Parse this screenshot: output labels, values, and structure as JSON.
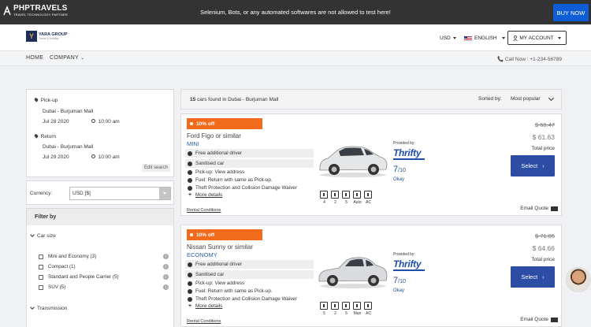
{
  "topbar": {
    "brand_name": "PHPTRAVELS",
    "brand_tagline": "TRAVEL TECHNOLOGY PARTNER",
    "notice": "Selenium, Bots, or any automated softwares are not allowed to test here!",
    "buy_now": "BUY NOW"
  },
  "header": {
    "logo_text": "YARA GROUP",
    "logo_sub": "Travel & Holiday",
    "currency": "USD",
    "language": "ENGLISH",
    "account": "MY ACCOUNT"
  },
  "nav": {
    "home": "HOME",
    "company": "COMPANY",
    "call": "Call Now : +1-234-56789"
  },
  "search": {
    "pickup_label": "Pick-up",
    "pickup_location": "Dubai - Burjuman Mall",
    "pickup_date": "Jul 28 2020",
    "pickup_time": "10:00 am",
    "return_label": "Return",
    "return_location": "Dubai - Burjuman Mall",
    "return_date": "Jul 29 2020",
    "return_time": "10:00 am",
    "edit": "Edit search"
  },
  "currency": {
    "label": "Currency:",
    "value": "USD [$]"
  },
  "filter": {
    "title": "Filter by",
    "car_size_label": "Car size",
    "car_sizes": [
      "Mini and Economy (3)",
      "Compact (1)",
      "Standard and People Carrier (5)",
      "SUV (5)"
    ],
    "transmission_label": "Transmission"
  },
  "results": {
    "count_num": "15",
    "count_text": "cars found in Dubai - Burjuman Mall",
    "sorted_label": "Sorted by:",
    "sorted_value": "Most popular"
  },
  "cars": [
    {
      "offer": "10% off",
      "name": "Ford Figo or similar",
      "type": "MINI",
      "features": [
        "Free additional driver",
        "Sanitised car"
      ],
      "pickup": "Pick-up: View address",
      "fuel": "Fuel: Return with same as Pick-up.",
      "theft": "Theft Protection and Collision Damage Waiver",
      "more": "More details",
      "rental": "Rental Conditions",
      "specs": [
        "4",
        "2",
        "5",
        "Auto",
        "AC"
      ],
      "provided": "Provided by:",
      "provider": "Thrifty",
      "rating": "7",
      "rating_of": "/10",
      "rating_text": "Okay",
      "old_price": "$ 68.47",
      "price": "$ 61.63",
      "total": "Total price",
      "select": "Select",
      "email": "Email Quote"
    },
    {
      "offer": "10% off",
      "name": "Nissan Sunny or similar",
      "type": "ECONOMY",
      "features": [
        "Free additional driver",
        "Sanitised car"
      ],
      "pickup": "Pick-up: View address",
      "fuel": "Fuel: Return with same as Pick-up.",
      "theft": "Theft Protection and Collision Damage Waiver",
      "more": "More details",
      "rental": "Rental Conditions",
      "specs": [
        "5",
        "2",
        "5",
        "Man",
        "AC"
      ],
      "provided": "Provided by:",
      "provider": "Thrifty",
      "rating": "7",
      "rating_of": "/10",
      "rating_text": "Okay",
      "old_price": "$ 71.85",
      "price": "$ 64.66",
      "total": "Total price",
      "select": "Select",
      "email": "Email Quote"
    }
  ],
  "colors": {
    "accent": "#0c5dd6",
    "offer": "#f26b1d",
    "select": "#2c4da3",
    "topbar": "#333333"
  }
}
